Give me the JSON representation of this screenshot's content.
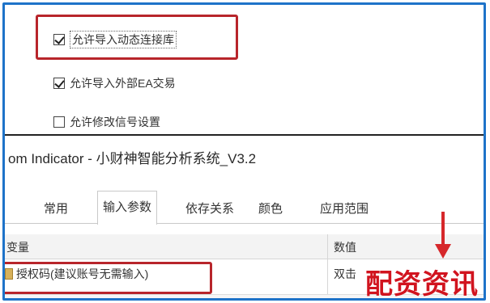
{
  "options": {
    "allow_dll": "允许导入动态连接库",
    "allow_external_ea": "允许导入外部EA交易",
    "allow_modify_signal": "允许修改信号设置"
  },
  "dialog": {
    "title": "om Indicator - 小财神智能分析系统_V3.2",
    "tab_fragment": "",
    "tabs": [
      "常用",
      "输入参数",
      "依存关系",
      "颜色",
      "应用范围"
    ],
    "table": {
      "col_variable": "变量",
      "col_value": "数值",
      "row_param": "授权码(建议账号无需输入)",
      "row_value": "双击"
    }
  },
  "watermark": "配资资讯",
  "colors": {
    "highlight_box": "#b8252b",
    "arrow": "#d6282b",
    "frame": "#1e73c9"
  }
}
